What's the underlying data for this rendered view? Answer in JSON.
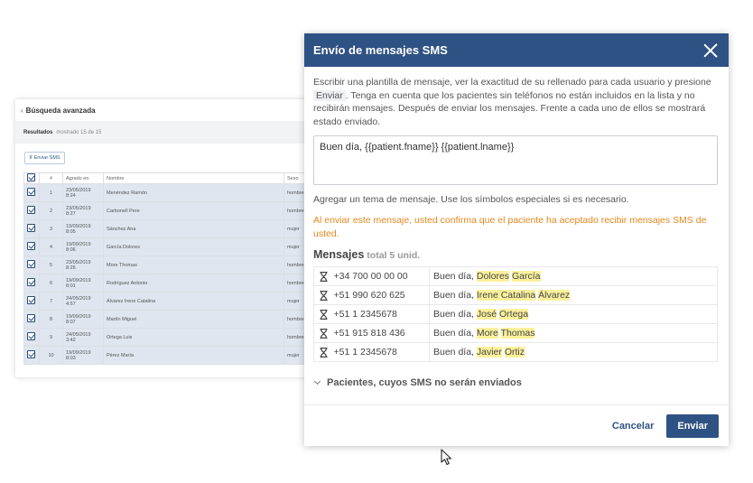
{
  "background_panel": {
    "title": "Búsqueda avanzada",
    "results_label": "Resultados",
    "results_count": "mostrado 15 de 15",
    "send_sms_button": "Enviar SMS",
    "columns": [
      "",
      "#",
      "Agrado en",
      "Nombre",
      "Sexo"
    ],
    "rows": [
      {
        "num": "1",
        "date": "23/05/2019",
        "time": "8:24",
        "name": "Menéndez Ramón",
        "sex": "hombre"
      },
      {
        "num": "2",
        "date": "23/05/2019",
        "time": "8:27",
        "name": "Carbonell Pere",
        "sex": "hombre"
      },
      {
        "num": "3",
        "date": "19/09/2019",
        "time": "8:05",
        "name": "Sánchez Ana",
        "sex": "mujer"
      },
      {
        "num": "4",
        "date": "19/09/2019",
        "time": "8:06",
        "name": "García Dolores",
        "sex": "mujer"
      },
      {
        "num": "5",
        "date": "23/05/2019",
        "time": "8:26",
        "name": "More Thomas",
        "sex": "hombre"
      },
      {
        "num": "6",
        "date": "19/09/2019",
        "time": "8:01",
        "name": "Rodríguez Antonio",
        "sex": "hombre"
      },
      {
        "num": "7",
        "date": "24/05/2019",
        "time": "4:57",
        "name": "Álvarez Irene Catalina",
        "sex": "mujer"
      },
      {
        "num": "8",
        "date": "19/09/2019",
        "time": "8:07",
        "name": "Martín Miguel",
        "sex": "hombre"
      },
      {
        "num": "9",
        "date": "24/05/2019",
        "time": "3:42",
        "name": "Ortega Luis",
        "sex": "hombre"
      },
      {
        "num": "10",
        "date": "19/09/2019",
        "time": "8:03",
        "name": "Pérez María",
        "sex": "mujer"
      }
    ]
  },
  "modal": {
    "title": "Envío de mensajes SMS",
    "intro_before": "Escribir una plantilla de mensaje, ver la exactitud de su rellenado para cada usuario y presione ",
    "intro_button": "Enviar",
    "intro_after": ". Tenga en cuenta que los pacientes sin teléfonos no están incluidos en la lista y no recibirán mensajes. Después de enviar los mensajes. Frente a cada uno de ellos se mostrará estado enviado.",
    "message_template": "Buen día, {{patient.fname}} {{patient.lname}}",
    "hint": "Agregar un tema de mensaje. Use los símbolos especiales si es necesario.",
    "warning": "Al enviar este mensaje, usted confirma que el paciente ha aceptado recibir mensajes SMS de usted.",
    "messages_title": "Mensajes",
    "messages_total": "total 5 unid.",
    "greeting": "Buen día,",
    "messages": [
      {
        "phone": "+34 700 00 00 00",
        "fname": "Dolores",
        "lname": "García"
      },
      {
        "phone": "+51 990 620 625",
        "fname": "Irene Catalina",
        "lname": "Álvarez"
      },
      {
        "phone": "+51 1 2345678",
        "fname": "José",
        "lname": "Ortega"
      },
      {
        "phone": "+51 915 818 436",
        "fname": "More",
        "lname": "Thomas"
      },
      {
        "phone": "+51 1 2345678",
        "fname": "Javier",
        "lname": "Ortiz"
      }
    ],
    "not_sent_label": "Pacientes, cuyos SMS no serán enviados",
    "cancel_label": "Cancelar",
    "send_label": "Enviar"
  },
  "colors": {
    "header_bg": "#2f5284",
    "highlight": "#fbf19c",
    "warning": "#e4871d"
  }
}
